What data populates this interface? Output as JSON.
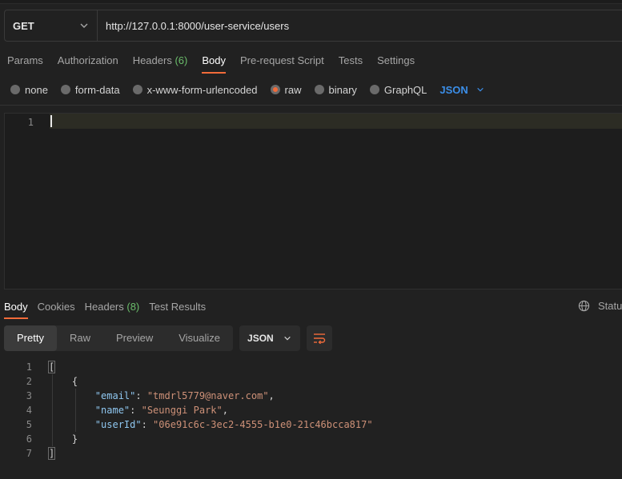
{
  "request": {
    "method": "GET",
    "url": "http://127.0.0.1:8000/user-service/users"
  },
  "request_tabs": [
    {
      "label": "Params"
    },
    {
      "label": "Authorization"
    },
    {
      "label": "Headers",
      "count": "(6)"
    },
    {
      "label": "Body",
      "active": true
    },
    {
      "label": "Pre-request Script"
    },
    {
      "label": "Tests"
    },
    {
      "label": "Settings"
    }
  ],
  "body_types": {
    "none": "none",
    "form_data": "form-data",
    "urlencoded": "x-www-form-urlencoded",
    "raw": "raw",
    "binary": "binary",
    "graphql": "GraphQL",
    "language": "JSON"
  },
  "editor": {
    "line_number": "1"
  },
  "response_tabs": {
    "body": "Body",
    "cookies": "Cookies",
    "headers": "Headers",
    "headers_count": "(8)",
    "test_results": "Test Results"
  },
  "status_label": "Statu",
  "view_modes": {
    "pretty": "Pretty",
    "raw": "Raw",
    "preview": "Preview",
    "visualize": "Visualize"
  },
  "response_format": "JSON",
  "response_lines": {
    "n1": "1",
    "n2": "2",
    "n3": "3",
    "n4": "4",
    "n5": "5",
    "n6": "6",
    "n7": "7",
    "open_bracket": "[",
    "open_brace": "{",
    "email_key": "\"email\"",
    "email_value": "\"tmdrl5779@naver.com\"",
    "name_key": "\"name\"",
    "name_value": "\"Seunggi Park\"",
    "userid_key": "\"userId\"",
    "userid_value": "\"06e91c6c-3ec2-4555-b1e0-21c46bcca817\"",
    "close_brace": "}",
    "close_bracket": "]"
  },
  "colors": {
    "accent": "#f26b3a",
    "link_blue": "#3b8ee8",
    "count_green": "#6bbd6b",
    "json_key": "#8fc7f0",
    "json_string": "#ce9178"
  }
}
